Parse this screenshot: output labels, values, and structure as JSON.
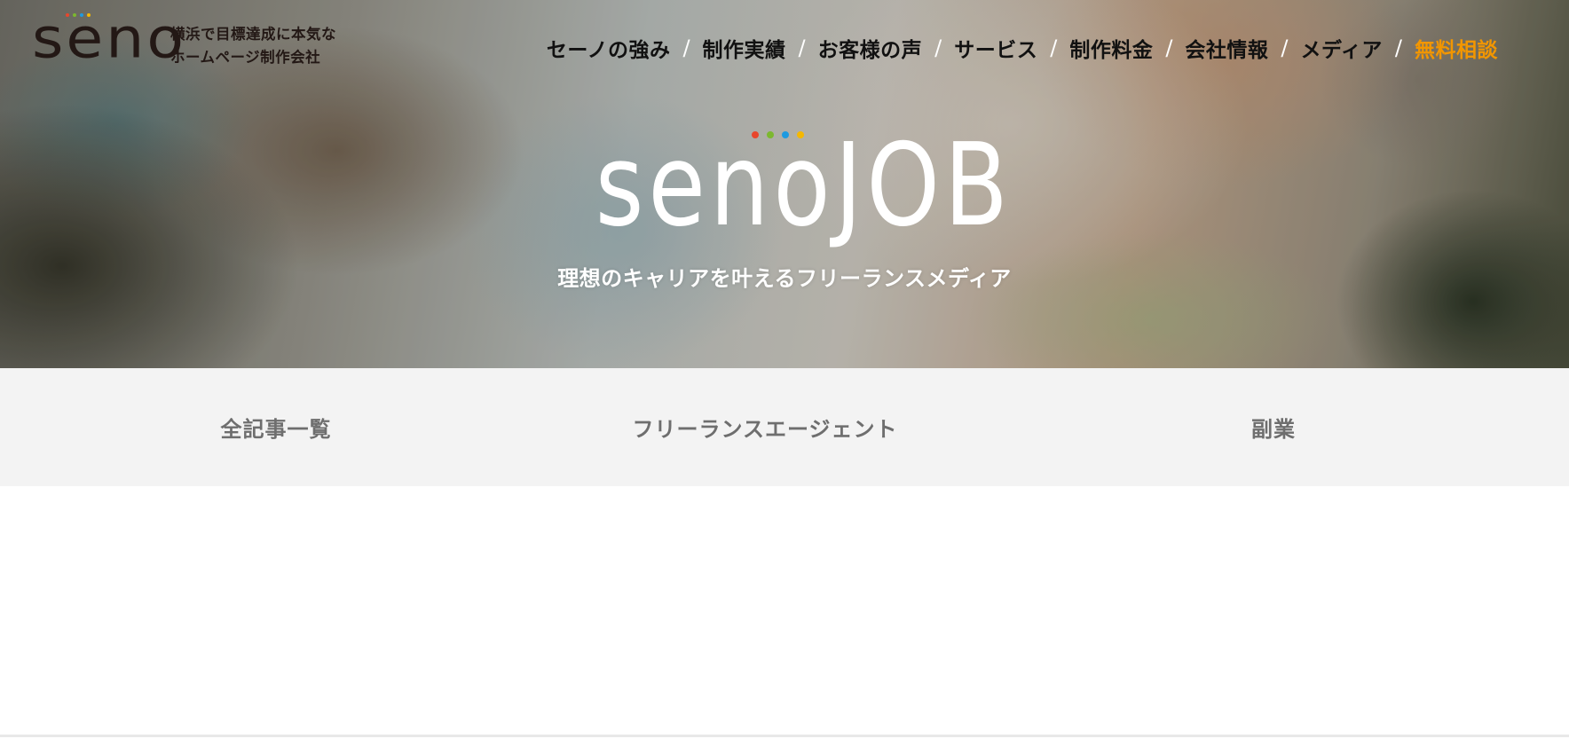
{
  "brand": {
    "logo_text": "seno",
    "tagline_line1": "横浜で目標達成に本気な",
    "tagline_line2": "ホームページ制作会社",
    "dot_colors": [
      "#e8462c",
      "#7cb82f",
      "#1e9ae0",
      "#f5b800"
    ]
  },
  "nav": {
    "items": [
      {
        "label": "セーノの強み"
      },
      {
        "label": "制作実績"
      },
      {
        "label": "お客様の声"
      },
      {
        "label": "サービス"
      },
      {
        "label": "制作料金"
      },
      {
        "label": "会社情報"
      },
      {
        "label": "メディア"
      },
      {
        "label": "無料相談",
        "accent": "#f29600"
      }
    ],
    "separator": "/"
  },
  "hero": {
    "logo_text": "senoJOB",
    "subtitle": "理想のキャリアを叶えるフリーランスメディア"
  },
  "categories": [
    {
      "label": "全記事一覧"
    },
    {
      "label": "フリーランスエージェント"
    },
    {
      "label": "副業"
    }
  ]
}
